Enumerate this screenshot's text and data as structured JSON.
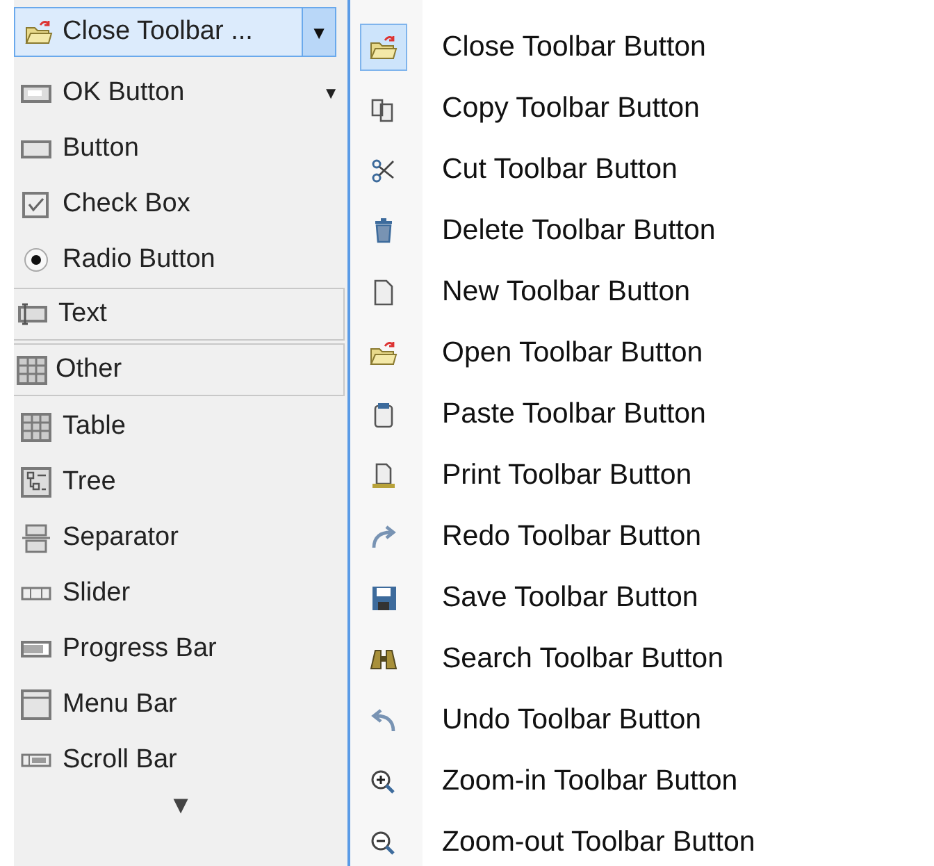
{
  "palette": {
    "selector": {
      "label": "Close Toolbar ...",
      "arrow": "▼"
    },
    "items": [
      {
        "kind": "item",
        "label": "OK Button",
        "arrow": "▼"
      },
      {
        "kind": "item",
        "label": "Button"
      },
      {
        "kind": "item",
        "label": "Check Box"
      },
      {
        "kind": "item",
        "label": "Radio Button"
      },
      {
        "kind": "header",
        "label": "Text"
      },
      {
        "kind": "header",
        "label": "Other"
      },
      {
        "kind": "item",
        "label": "Table"
      },
      {
        "kind": "item",
        "label": "Tree"
      },
      {
        "kind": "item",
        "label": "Separator"
      },
      {
        "kind": "item",
        "label": "Slider"
      },
      {
        "kind": "item",
        "label": "Progress Bar"
      },
      {
        "kind": "item",
        "label": "Menu Bar"
      },
      {
        "kind": "item",
        "label": "Scroll Bar"
      }
    ],
    "more_arrow": "▼"
  },
  "menu": {
    "items": [
      {
        "label": "Close Toolbar Button",
        "selected": true
      },
      {
        "label": "Copy Toolbar Button",
        "selected": false
      },
      {
        "label": "Cut Toolbar Button",
        "selected": false
      },
      {
        "label": "Delete Toolbar Button",
        "selected": false
      },
      {
        "label": "New Toolbar Button",
        "selected": false
      },
      {
        "label": "Open Toolbar Button",
        "selected": false
      },
      {
        "label": "Paste Toolbar Button",
        "selected": false
      },
      {
        "label": "Print Toolbar Button",
        "selected": false
      },
      {
        "label": "Redo Toolbar Button",
        "selected": false
      },
      {
        "label": "Save Toolbar Button",
        "selected": false
      },
      {
        "label": "Search Toolbar Button",
        "selected": false
      },
      {
        "label": "Undo Toolbar Button",
        "selected": false
      },
      {
        "label": "Zoom-in Toolbar Button",
        "selected": false
      },
      {
        "label": "Zoom-out Toolbar Button",
        "selected": false
      }
    ]
  }
}
